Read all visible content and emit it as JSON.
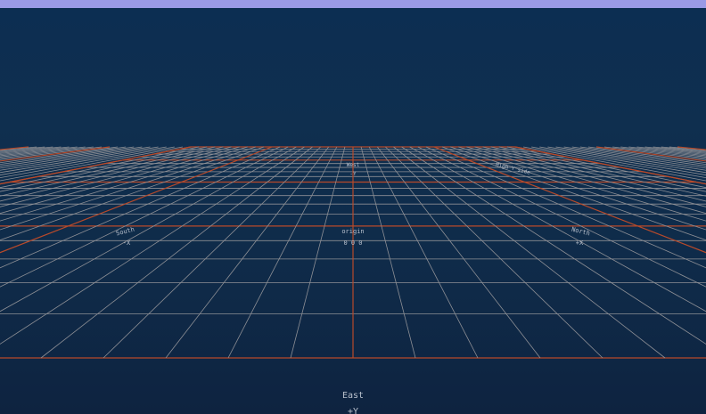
{
  "window": {
    "title_bar_color": "#9a9ae6"
  },
  "colors": {
    "sky_top": "#0c2e52",
    "sky_bottom": "#0e2340",
    "grid_minor": "#8d8f95",
    "grid_major": "#b84a2a"
  },
  "grid_labels": {
    "far": {
      "name": "West",
      "axis": "-Y"
    },
    "far_right": {
      "name": "High Y side"
    },
    "left": {
      "name": "South",
      "axis": "-X"
    },
    "center": {
      "name": "origin",
      "coords": "0 0 0"
    },
    "right": {
      "name": "North",
      "axis": "+X"
    },
    "near": {
      "name": "East",
      "axis": "+Y"
    }
  }
}
